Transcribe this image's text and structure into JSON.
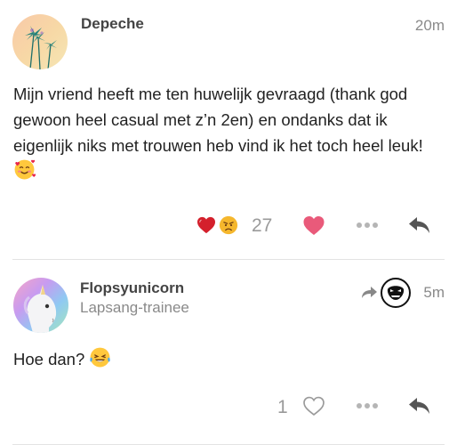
{
  "posts": [
    {
      "username": "Depeche",
      "timestamp": "20m",
      "body": "Mijn vriend heeft me ten huwelijk gevraagd (thank god gewoon heel casual met z’n 2en) en ondanks dat ik eigenlijk niks met trouwen heb vind ik het toch heel leuk!",
      "body_emoji": "smiling-face-with-hearts",
      "reactions": [
        "heart",
        "angry-face"
      ],
      "reaction_count": "27",
      "like_state": "liked",
      "like_color": "#e95a7a"
    },
    {
      "username": "Flopsyunicorn",
      "subtitle": "Lapsang-trainee",
      "timestamp": "5m",
      "body": "Hoe dan?",
      "body_emoji": "tears-of-joy",
      "reply_indicator": "reply-arrow",
      "like_count": "1",
      "like_state": "not-liked"
    }
  ],
  "colors": {
    "muted": "#8a8a8a",
    "icon": "#555555",
    "divider": "#e3e3e3"
  }
}
